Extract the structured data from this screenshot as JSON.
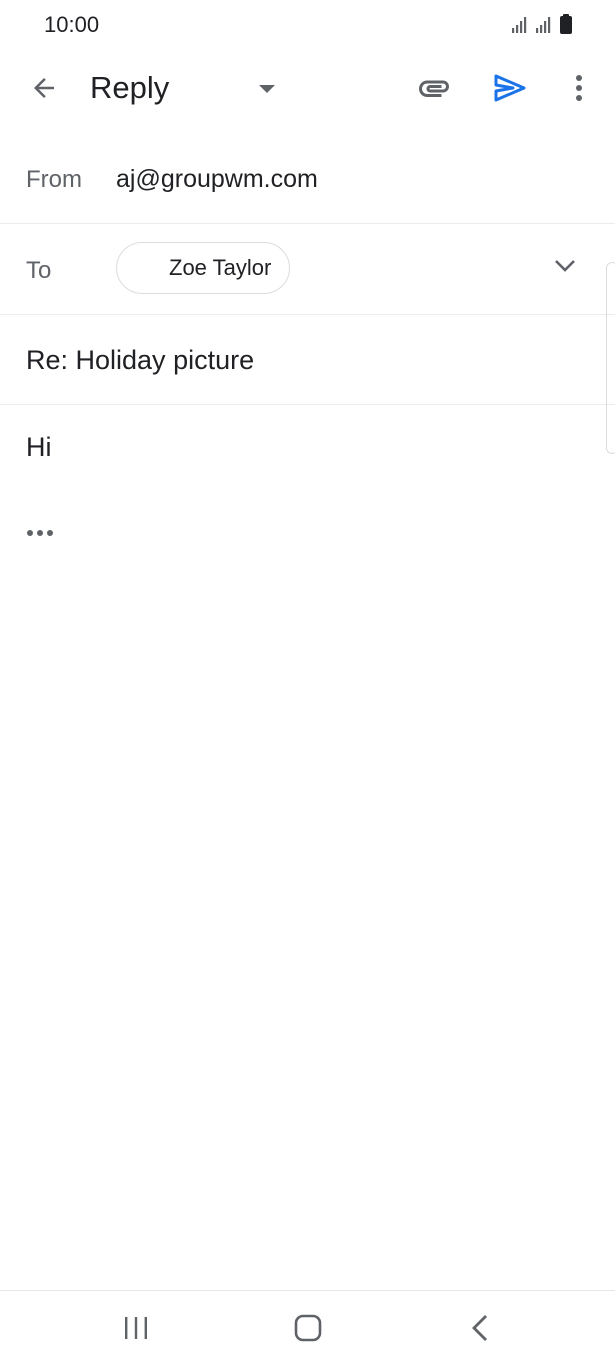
{
  "status_bar": {
    "time": "10:00",
    "icons": [
      "signal-icon",
      "signal-icon",
      "battery-icon"
    ]
  },
  "app_bar": {
    "title": "Reply",
    "icons": [
      "arrow-back-icon",
      "caret-down-icon",
      "paperclip-icon",
      "send-icon",
      "more-vert-icon"
    ],
    "send_color": "#1a73e8"
  },
  "compose": {
    "from_label": "From",
    "from_value": "aj@groupwm.com",
    "to_label": "To",
    "to_recipient": "Zoe Taylor",
    "subject": "Re: Holiday picture",
    "body": "Hi",
    "quoted_toggle": "•••"
  },
  "nav_bar": {
    "icons": [
      "recents-icon",
      "home-icon",
      "back-icon"
    ]
  }
}
